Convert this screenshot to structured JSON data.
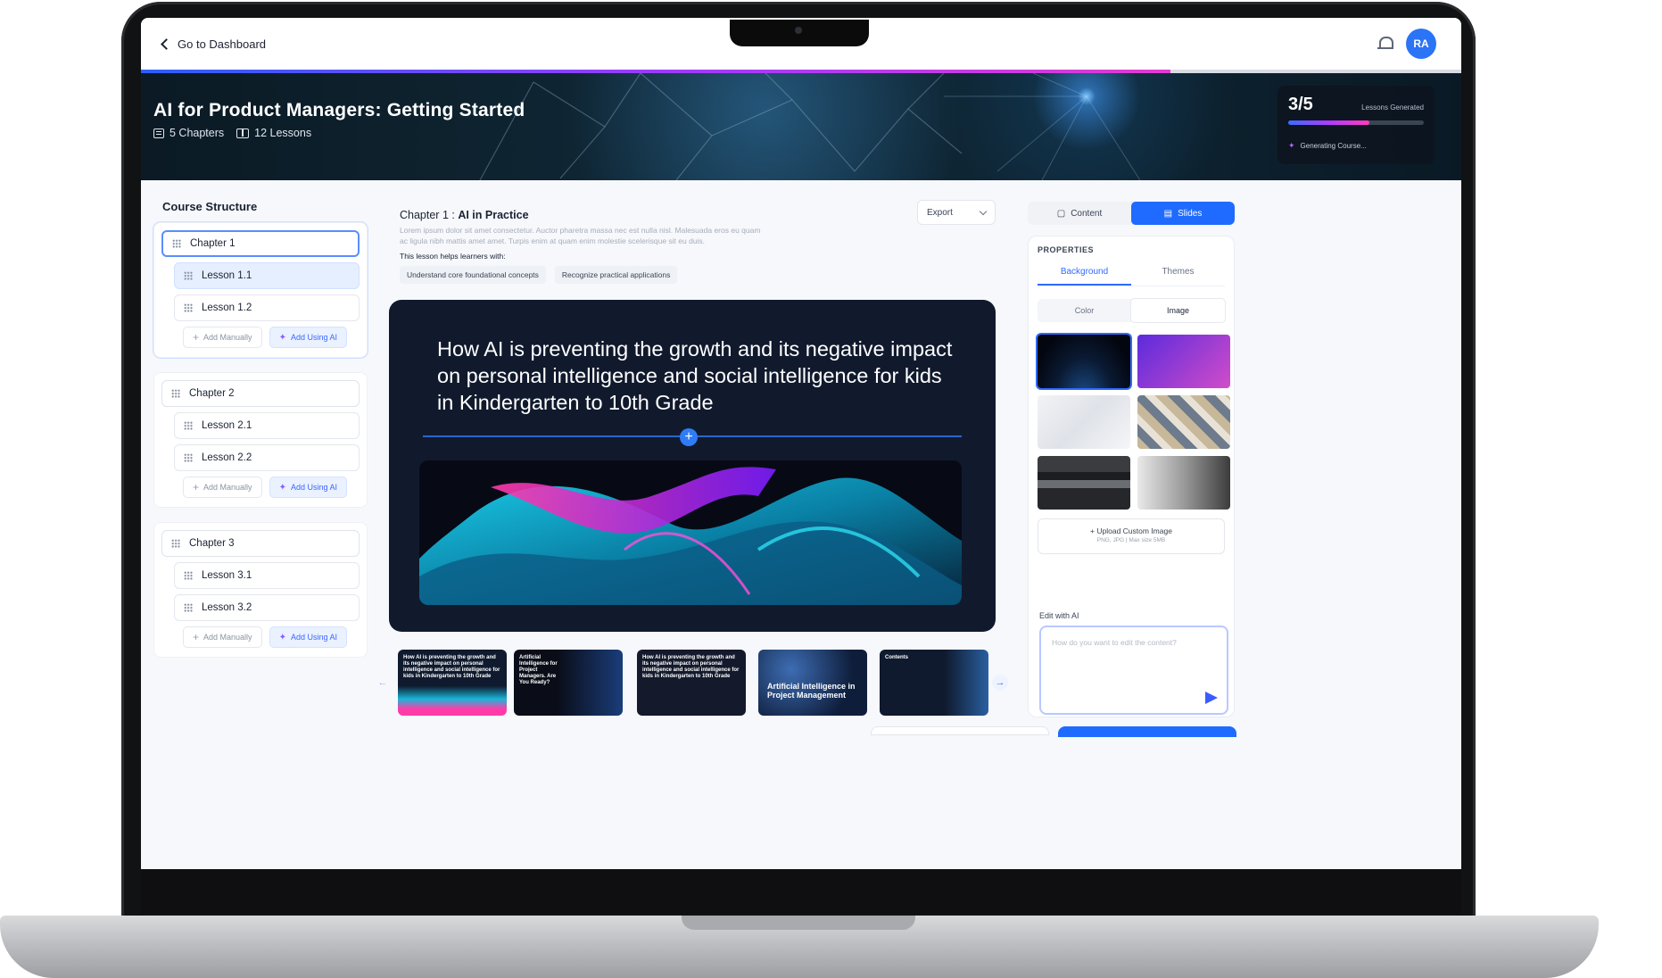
{
  "topbar": {
    "back_label": "Go to Dashboard",
    "avatar_initials": "RA"
  },
  "hero": {
    "title": "AI for Product Managers: Getting Started",
    "chapters_label": "5 Chapters",
    "lessons_label": "12 Lessons",
    "progress": {
      "count": "3/5",
      "label": "Lessons Generated",
      "status": "Generating Course..."
    }
  },
  "sidebar": {
    "title": "Course Structure",
    "chapters": [
      {
        "label": "Chapter 1",
        "lessons": [
          "Lesson 1.1",
          "Lesson 1.2"
        ],
        "add_manual": "Add Manually",
        "add_ai": "Add Using AI"
      },
      {
        "label": "Chapter 2",
        "lessons": [
          "Lesson 2.1",
          "Lesson 2.2"
        ],
        "add_manual": "Add Manually",
        "add_ai": "Add Using AI"
      },
      {
        "label": "Chapter 3",
        "lessons": [
          "Lesson 3.1",
          "Lesson 3.2"
        ],
        "add_manual": "Add Manually",
        "add_ai": "Add Using AI"
      }
    ]
  },
  "content": {
    "chapter_prefix": "Chapter 1 :",
    "chapter_name": "AI in Practice",
    "description": "Lorem ipsum dolor sit amet consectetur. Auctor pharetra massa nec est nulla nisl. Malesuada eros eu quam ac ligula nibh mattis amet amet. Turpis enim at quam enim molestie scelerisque sit eu duis.",
    "helps_label": "This lesson helps learners with:",
    "chips": [
      "Understand core foundational concepts",
      "Recognize practical applications"
    ],
    "export_label": "Export",
    "slide_title": "How AI is preventing the growth and its negative impact on personal intelligence and social intelligence for kids in Kindergarten to 10th Grade",
    "thumbnails": [
      {
        "text": "How AI is preventing the growth and its negative impact on personal intelligence and social intelligence for kids in Kindergarten to 10th Grade"
      },
      {
        "text": "Artificial Intelligence for Project Managers. Are You Ready?"
      },
      {
        "text": "How AI is preventing the growth and its negative impact on personal intelligence and social intelligence for kids in Kindergarten to 10th Grade"
      },
      {
        "text": "Artificial Intelligence in Project Management"
      },
      {
        "text": "Contents"
      }
    ]
  },
  "panel": {
    "tab_content": "Content",
    "tab_slides": "Slides",
    "properties_title": "PROPERTIES",
    "subtab_background": "Background",
    "subtab_themes": "Themes",
    "toggle_color": "Color",
    "toggle_image": "Image",
    "upload_label": "+ Upload Custom Image",
    "upload_hint": "PNG, JPG | Max size 5MB",
    "edit_label": "Edit with AI",
    "edit_placeholder": "How do you want to edit the content?"
  },
  "colors": {
    "accent": "#1f6bff",
    "slide_bg": "#111a2d",
    "ai_purple": "#8b5cff"
  }
}
